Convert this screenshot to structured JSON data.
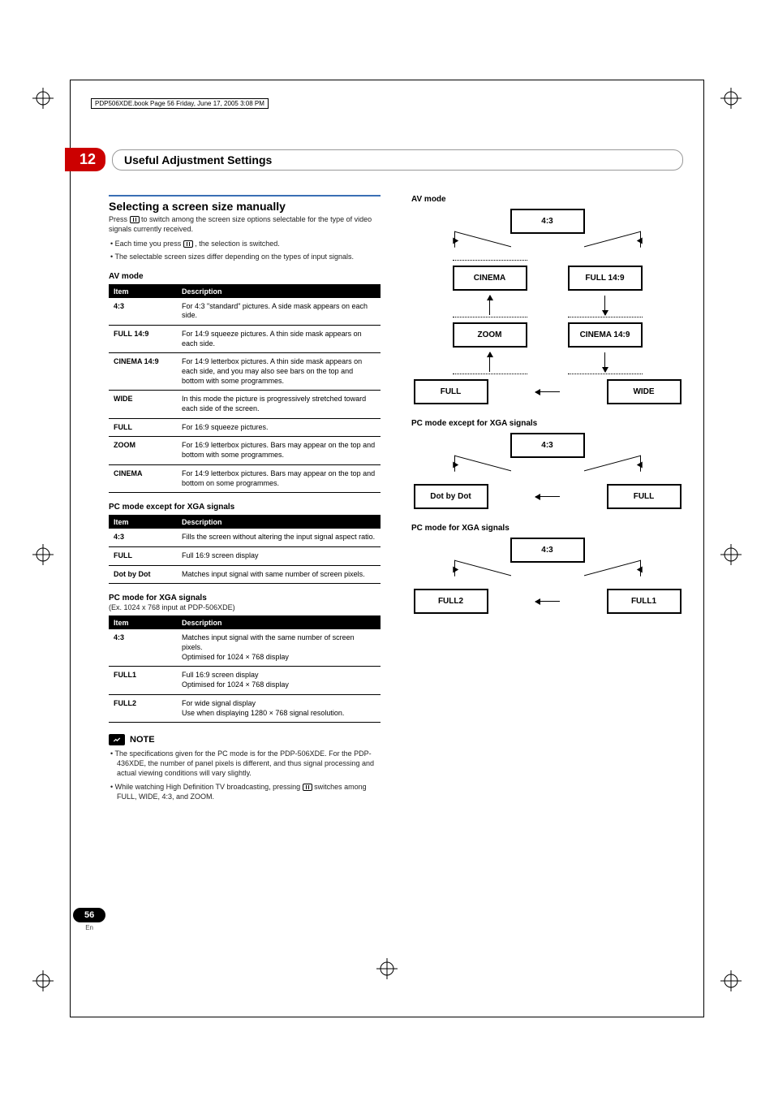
{
  "meta": {
    "header_path": "PDP506XDE.book  Page 56  Friday, June 17, 2005  3:08 PM"
  },
  "section": {
    "number": "12",
    "title": "Useful Adjustment Settings"
  },
  "left": {
    "h_sel": "Selecting a screen size manually",
    "intro_a": "Press ",
    "intro_b": " to switch among the screen size options selectable for the type of video signals currently received.",
    "bullet1_a": "Each time you press ",
    "bullet1_b": ", the selection is switched.",
    "bullet2": "The selectable screen sizes differ depending on the types of input signals.",
    "av_mode_h": "AV mode",
    "th_item": "Item",
    "th_desc": "Description",
    "av_rows": [
      {
        "item": "4:3",
        "desc": "For 4:3 \"standard\" pictures. A side mask appears on each side."
      },
      {
        "item": "FULL 14:9",
        "desc": "For 14:9 squeeze pictures. A thin side mask appears on each side."
      },
      {
        "item": "CINEMA 14:9",
        "desc": "For 14:9 letterbox pictures. A thin side mask appears on each side, and you may also see bars on the top and bottom with some programmes."
      },
      {
        "item": "WIDE",
        "desc": "In this mode the picture is progressively stretched toward each side of the screen."
      },
      {
        "item": "FULL",
        "desc": "For 16:9 squeeze pictures."
      },
      {
        "item": "ZOOM",
        "desc": "For 16:9 letterbox pictures. Bars may appear on the top and bottom with some programmes."
      },
      {
        "item": "CINEMA",
        "desc": "For 14:9 letterbox pictures. Bars may appear on the top and bottom on some programmes."
      }
    ],
    "pc_except_h": "PC mode except for XGA signals",
    "pc_except_rows": [
      {
        "item": "4:3",
        "desc": "Fills the screen without altering the input signal aspect ratio."
      },
      {
        "item": "FULL",
        "desc": "Full 16:9 screen display"
      },
      {
        "item": "Dot by Dot",
        "desc": "Matches input signal with same number of screen pixels."
      }
    ],
    "pc_xga_h": "PC mode for XGA signals",
    "pc_xga_sub": "(Ex. 1024 x 768 input at PDP-506XDE)",
    "pc_xga_rows": [
      {
        "item": "4:3",
        "desc": "Matches input signal with the same number of screen pixels.\nOptimised for 1024 × 768 display"
      },
      {
        "item": "FULL1",
        "desc": "Full 16:9 screen display\nOptimised for 1024 × 768 display"
      },
      {
        "item": "FULL2",
        "desc": "For wide signal display\nUse when displaying 1280 × 768 signal resolution."
      }
    ],
    "note_label": "NOTE",
    "note1": "The specifications given for the PC mode is for the PDP-506XDE. For the PDP-436XDE, the number of panel pixels is different, and thus signal processing and actual viewing conditions will vary slightly.",
    "note2_a": "While watching High Definition TV broadcasting, pressing ",
    "note2_b": " switches among FULL, WIDE, 4:3, and ZOOM."
  },
  "right": {
    "av_mode_h": "AV mode",
    "nodes": {
      "n43": "4:3",
      "cinema": "CINEMA",
      "full149": "FULL 14:9",
      "zoom": "ZOOM",
      "cinema149": "CINEMA 14:9",
      "full": "FULL",
      "wide": "WIDE",
      "dotbydot": "Dot by Dot",
      "full1": "FULL1",
      "full2": "FULL2"
    },
    "pc_except_h": "PC mode except for XGA signals",
    "pc_xga_h": "PC mode for XGA signals"
  },
  "footer": {
    "page": "56",
    "lang": "En"
  }
}
